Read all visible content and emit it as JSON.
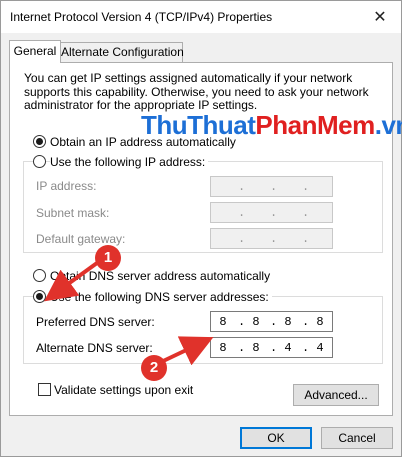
{
  "window": {
    "title": "Internet Protocol Version 4 (TCP/IPv4) Properties",
    "close_glyph": "✕"
  },
  "tabs": [
    {
      "label": "General",
      "active": true
    },
    {
      "label": "Alternate Configuration",
      "active": false
    }
  ],
  "description": "You can get IP settings assigned automatically if your network supports this capability. Otherwise, you need to ask your network administrator for the appropriate IP settings.",
  "watermark": {
    "part1": "ThuThuat",
    "part2": "PhanMem",
    "part3": ".vn"
  },
  "ip_section": {
    "auto_label": "Obtain an IP address automatically",
    "auto_checked": true,
    "manual_label": "Use the following IP address:",
    "manual_checked": false,
    "fields": [
      {
        "label": "IP address:",
        "octets": [
          "",
          "",
          "",
          ""
        ]
      },
      {
        "label": "Subnet mask:",
        "octets": [
          "",
          "",
          "",
          ""
        ]
      },
      {
        "label": "Default gateway:",
        "octets": [
          "",
          "",
          "",
          ""
        ]
      }
    ]
  },
  "dns_section": {
    "auto_label": "Obtain DNS server address automatically",
    "auto_checked": false,
    "manual_label": "Use the following DNS server addresses:",
    "manual_checked": true,
    "preferred": {
      "label": "Preferred DNS server:",
      "octets": [
        "8",
        "8",
        "8",
        "8"
      ]
    },
    "alternate": {
      "label": "Alternate DNS server:",
      "octets": [
        "8",
        "8",
        "4",
        "4"
      ]
    }
  },
  "validate": {
    "label": "Validate settings upon exit",
    "checked": false
  },
  "buttons": {
    "advanced": "Advanced...",
    "ok": "OK",
    "cancel": "Cancel"
  },
  "annotations": [
    {
      "number": "1",
      "color": "#e0322b"
    },
    {
      "number": "2",
      "color": "#e0322b"
    }
  ]
}
